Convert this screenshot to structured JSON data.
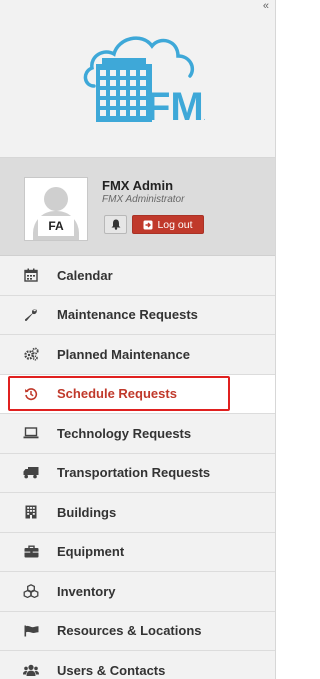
{
  "sidebar": {
    "collapse_glyph": "«",
    "logo": {
      "text": "FMX",
      "color": "#3ea8d8"
    },
    "user": {
      "name": "FMX Admin",
      "role": "FMX Administrator",
      "initials": "FA",
      "logout_label": "Log out",
      "logout_color": "#c0392b"
    },
    "items": [
      {
        "label": "Calendar",
        "icon": "calendar-icon"
      },
      {
        "label": "Maintenance Requests",
        "icon": "wrench-icon"
      },
      {
        "label": "Planned Maintenance",
        "icon": "gears-icon"
      },
      {
        "label": "Schedule Requests",
        "icon": "history-icon",
        "active": true
      },
      {
        "label": "Technology Requests",
        "icon": "laptop-icon"
      },
      {
        "label": "Transportation Requests",
        "icon": "truck-icon"
      },
      {
        "label": "Buildings",
        "icon": "building-icon"
      },
      {
        "label": "Equipment",
        "icon": "toolbox-icon"
      },
      {
        "label": "Inventory",
        "icon": "cubes-icon"
      },
      {
        "label": "Resources & Locations",
        "icon": "flag-icon"
      },
      {
        "label": "Users & Contacts",
        "icon": "users-icon"
      }
    ]
  }
}
